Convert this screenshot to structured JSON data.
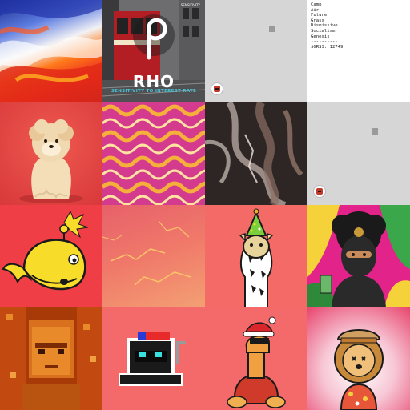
{
  "gallery": {
    "tiles": [
      {
        "name": "abstract-art-tile"
      },
      {
        "name": "rho-artwork-tile",
        "brand": "SENSITIVITY",
        "title": "RHO",
        "subtitle": "SENSITIVITY TO INTEREST RATE"
      },
      {
        "name": "placeholder-tile-1",
        "icon": "image-placeholder-icon"
      },
      {
        "name": "text-list-tile",
        "items": [
          "Camp",
          "Air",
          "Future",
          "Grass",
          "Dismissive",
          "Socialism",
          "Genesis"
        ],
        "divider": "----------",
        "total": "$GRSS: 12749"
      },
      {
        "name": "shiba-figure-tile"
      },
      {
        "name": "wave-pattern-tile"
      },
      {
        "name": "dark-organic-art-tile"
      },
      {
        "name": "placeholder-tile-2",
        "icon": "image-placeholder-icon"
      },
      {
        "name": "cartoon-whale-tile"
      },
      {
        "name": "cracked-gradient-tile"
      },
      {
        "name": "giraffe-party-hat-tile"
      },
      {
        "name": "masked-figure-tile"
      },
      {
        "name": "pixel-portrait-tile"
      },
      {
        "name": "pixel-robot-tile"
      },
      {
        "name": "santa-gator-tile"
      },
      {
        "name": "lion-cartoon-tile"
      }
    ]
  },
  "colors": {
    "placeholder_bg": "#d6d6d6",
    "coral": "#f46a66",
    "rho_accent": "#46c4d8"
  }
}
